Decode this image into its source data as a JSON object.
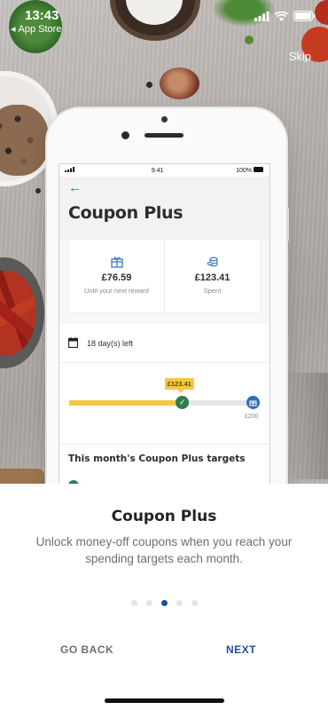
{
  "status_bar": {
    "time": "13:43",
    "back_app": "App Store"
  },
  "skip_label": "Skip",
  "mock_screen": {
    "status_time": "9:41",
    "battery": "100%",
    "title": "Coupon Plus",
    "cards": [
      {
        "amount": "£76.59",
        "label": "Until your next reward",
        "icon": "gift-icon"
      },
      {
        "amount": "£123.41",
        "label": "Spent",
        "icon": "coins-icon"
      }
    ],
    "days_left": "18 day(s) left",
    "progress": {
      "current_label": "£123.41",
      "goal_label": "£200",
      "spent": 123.41,
      "target": 200
    },
    "targets_heading": "This month's Coupon Plus targets"
  },
  "onboarding": {
    "title": "Coupon Plus",
    "description": "Unlock money-off coupons when you reach your spending targets each month.",
    "page_count": 5,
    "active_page": 3,
    "back_label": "GO BACK",
    "next_label": "NEXT"
  },
  "colors": {
    "accent": "#1f4f9c",
    "progress_fill": "#f5c842",
    "success": "#2e7d4f",
    "muted_text": "#6a6f78"
  }
}
